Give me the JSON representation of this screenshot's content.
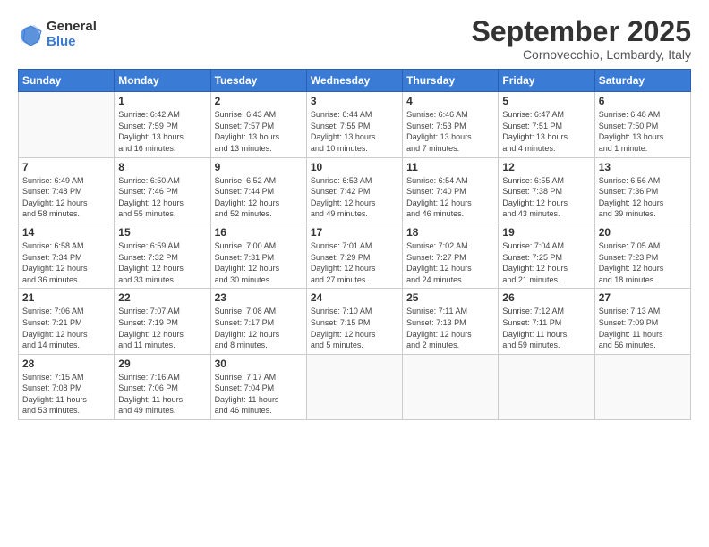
{
  "logo": {
    "general": "General",
    "blue": "Blue"
  },
  "header": {
    "title": "September 2025",
    "location": "Cornovecchio, Lombardy, Italy"
  },
  "weekdays": [
    "Sunday",
    "Monday",
    "Tuesday",
    "Wednesday",
    "Thursday",
    "Friday",
    "Saturday"
  ],
  "weeks": [
    [
      {
        "day": "",
        "info": ""
      },
      {
        "day": "1",
        "info": "Sunrise: 6:42 AM\nSunset: 7:59 PM\nDaylight: 13 hours\nand 16 minutes."
      },
      {
        "day": "2",
        "info": "Sunrise: 6:43 AM\nSunset: 7:57 PM\nDaylight: 13 hours\nand 13 minutes."
      },
      {
        "day": "3",
        "info": "Sunrise: 6:44 AM\nSunset: 7:55 PM\nDaylight: 13 hours\nand 10 minutes."
      },
      {
        "day": "4",
        "info": "Sunrise: 6:46 AM\nSunset: 7:53 PM\nDaylight: 13 hours\nand 7 minutes."
      },
      {
        "day": "5",
        "info": "Sunrise: 6:47 AM\nSunset: 7:51 PM\nDaylight: 13 hours\nand 4 minutes."
      },
      {
        "day": "6",
        "info": "Sunrise: 6:48 AM\nSunset: 7:50 PM\nDaylight: 13 hours\nand 1 minute."
      }
    ],
    [
      {
        "day": "7",
        "info": "Sunrise: 6:49 AM\nSunset: 7:48 PM\nDaylight: 12 hours\nand 58 minutes."
      },
      {
        "day": "8",
        "info": "Sunrise: 6:50 AM\nSunset: 7:46 PM\nDaylight: 12 hours\nand 55 minutes."
      },
      {
        "day": "9",
        "info": "Sunrise: 6:52 AM\nSunset: 7:44 PM\nDaylight: 12 hours\nand 52 minutes."
      },
      {
        "day": "10",
        "info": "Sunrise: 6:53 AM\nSunset: 7:42 PM\nDaylight: 12 hours\nand 49 minutes."
      },
      {
        "day": "11",
        "info": "Sunrise: 6:54 AM\nSunset: 7:40 PM\nDaylight: 12 hours\nand 46 minutes."
      },
      {
        "day": "12",
        "info": "Sunrise: 6:55 AM\nSunset: 7:38 PM\nDaylight: 12 hours\nand 43 minutes."
      },
      {
        "day": "13",
        "info": "Sunrise: 6:56 AM\nSunset: 7:36 PM\nDaylight: 12 hours\nand 39 minutes."
      }
    ],
    [
      {
        "day": "14",
        "info": "Sunrise: 6:58 AM\nSunset: 7:34 PM\nDaylight: 12 hours\nand 36 minutes."
      },
      {
        "day": "15",
        "info": "Sunrise: 6:59 AM\nSunset: 7:32 PM\nDaylight: 12 hours\nand 33 minutes."
      },
      {
        "day": "16",
        "info": "Sunrise: 7:00 AM\nSunset: 7:31 PM\nDaylight: 12 hours\nand 30 minutes."
      },
      {
        "day": "17",
        "info": "Sunrise: 7:01 AM\nSunset: 7:29 PM\nDaylight: 12 hours\nand 27 minutes."
      },
      {
        "day": "18",
        "info": "Sunrise: 7:02 AM\nSunset: 7:27 PM\nDaylight: 12 hours\nand 24 minutes."
      },
      {
        "day": "19",
        "info": "Sunrise: 7:04 AM\nSunset: 7:25 PM\nDaylight: 12 hours\nand 21 minutes."
      },
      {
        "day": "20",
        "info": "Sunrise: 7:05 AM\nSunset: 7:23 PM\nDaylight: 12 hours\nand 18 minutes."
      }
    ],
    [
      {
        "day": "21",
        "info": "Sunrise: 7:06 AM\nSunset: 7:21 PM\nDaylight: 12 hours\nand 14 minutes."
      },
      {
        "day": "22",
        "info": "Sunrise: 7:07 AM\nSunset: 7:19 PM\nDaylight: 12 hours\nand 11 minutes."
      },
      {
        "day": "23",
        "info": "Sunrise: 7:08 AM\nSunset: 7:17 PM\nDaylight: 12 hours\nand 8 minutes."
      },
      {
        "day": "24",
        "info": "Sunrise: 7:10 AM\nSunset: 7:15 PM\nDaylight: 12 hours\nand 5 minutes."
      },
      {
        "day": "25",
        "info": "Sunrise: 7:11 AM\nSunset: 7:13 PM\nDaylight: 12 hours\nand 2 minutes."
      },
      {
        "day": "26",
        "info": "Sunrise: 7:12 AM\nSunset: 7:11 PM\nDaylight: 11 hours\nand 59 minutes."
      },
      {
        "day": "27",
        "info": "Sunrise: 7:13 AM\nSunset: 7:09 PM\nDaylight: 11 hours\nand 56 minutes."
      }
    ],
    [
      {
        "day": "28",
        "info": "Sunrise: 7:15 AM\nSunset: 7:08 PM\nDaylight: 11 hours\nand 53 minutes."
      },
      {
        "day": "29",
        "info": "Sunrise: 7:16 AM\nSunset: 7:06 PM\nDaylight: 11 hours\nand 49 minutes."
      },
      {
        "day": "30",
        "info": "Sunrise: 7:17 AM\nSunset: 7:04 PM\nDaylight: 11 hours\nand 46 minutes."
      },
      {
        "day": "",
        "info": ""
      },
      {
        "day": "",
        "info": ""
      },
      {
        "day": "",
        "info": ""
      },
      {
        "day": "",
        "info": ""
      }
    ]
  ]
}
